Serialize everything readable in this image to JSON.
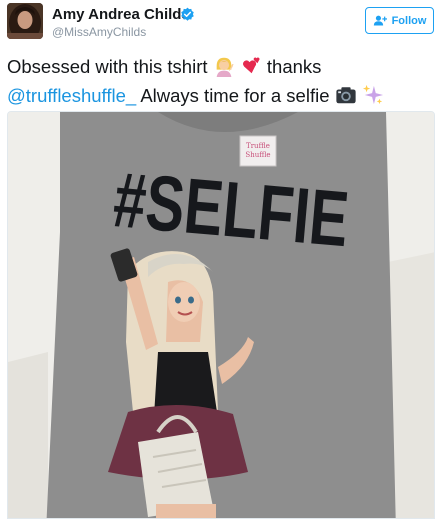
{
  "user": {
    "display_name": "Amy Andrea Childs",
    "handle": "@MissAmyChilds",
    "verified": true
  },
  "follow_button": {
    "label": "Follow",
    "icon": "add-user-icon"
  },
  "tweet": {
    "text_part1": "Obsessed with this tshirt",
    "text_part2": "thanks",
    "mention": "@truffleshuffle_",
    "text_part3": "Always time for a selfie",
    "emojis": [
      "woman-tipping-hand-emoji",
      "two-hearts-emoji",
      "camera-emoji",
      "sparkles-emoji"
    ]
  },
  "photo": {
    "shirt_print": "#SELFIE",
    "label_lines": [
      "Truffle",
      "Shuffle"
    ]
  },
  "colors": {
    "accent": "#1da1f2",
    "mention": "#1b95e0",
    "handle": "#8a96a2",
    "shirt": "#8c8c8c"
  }
}
